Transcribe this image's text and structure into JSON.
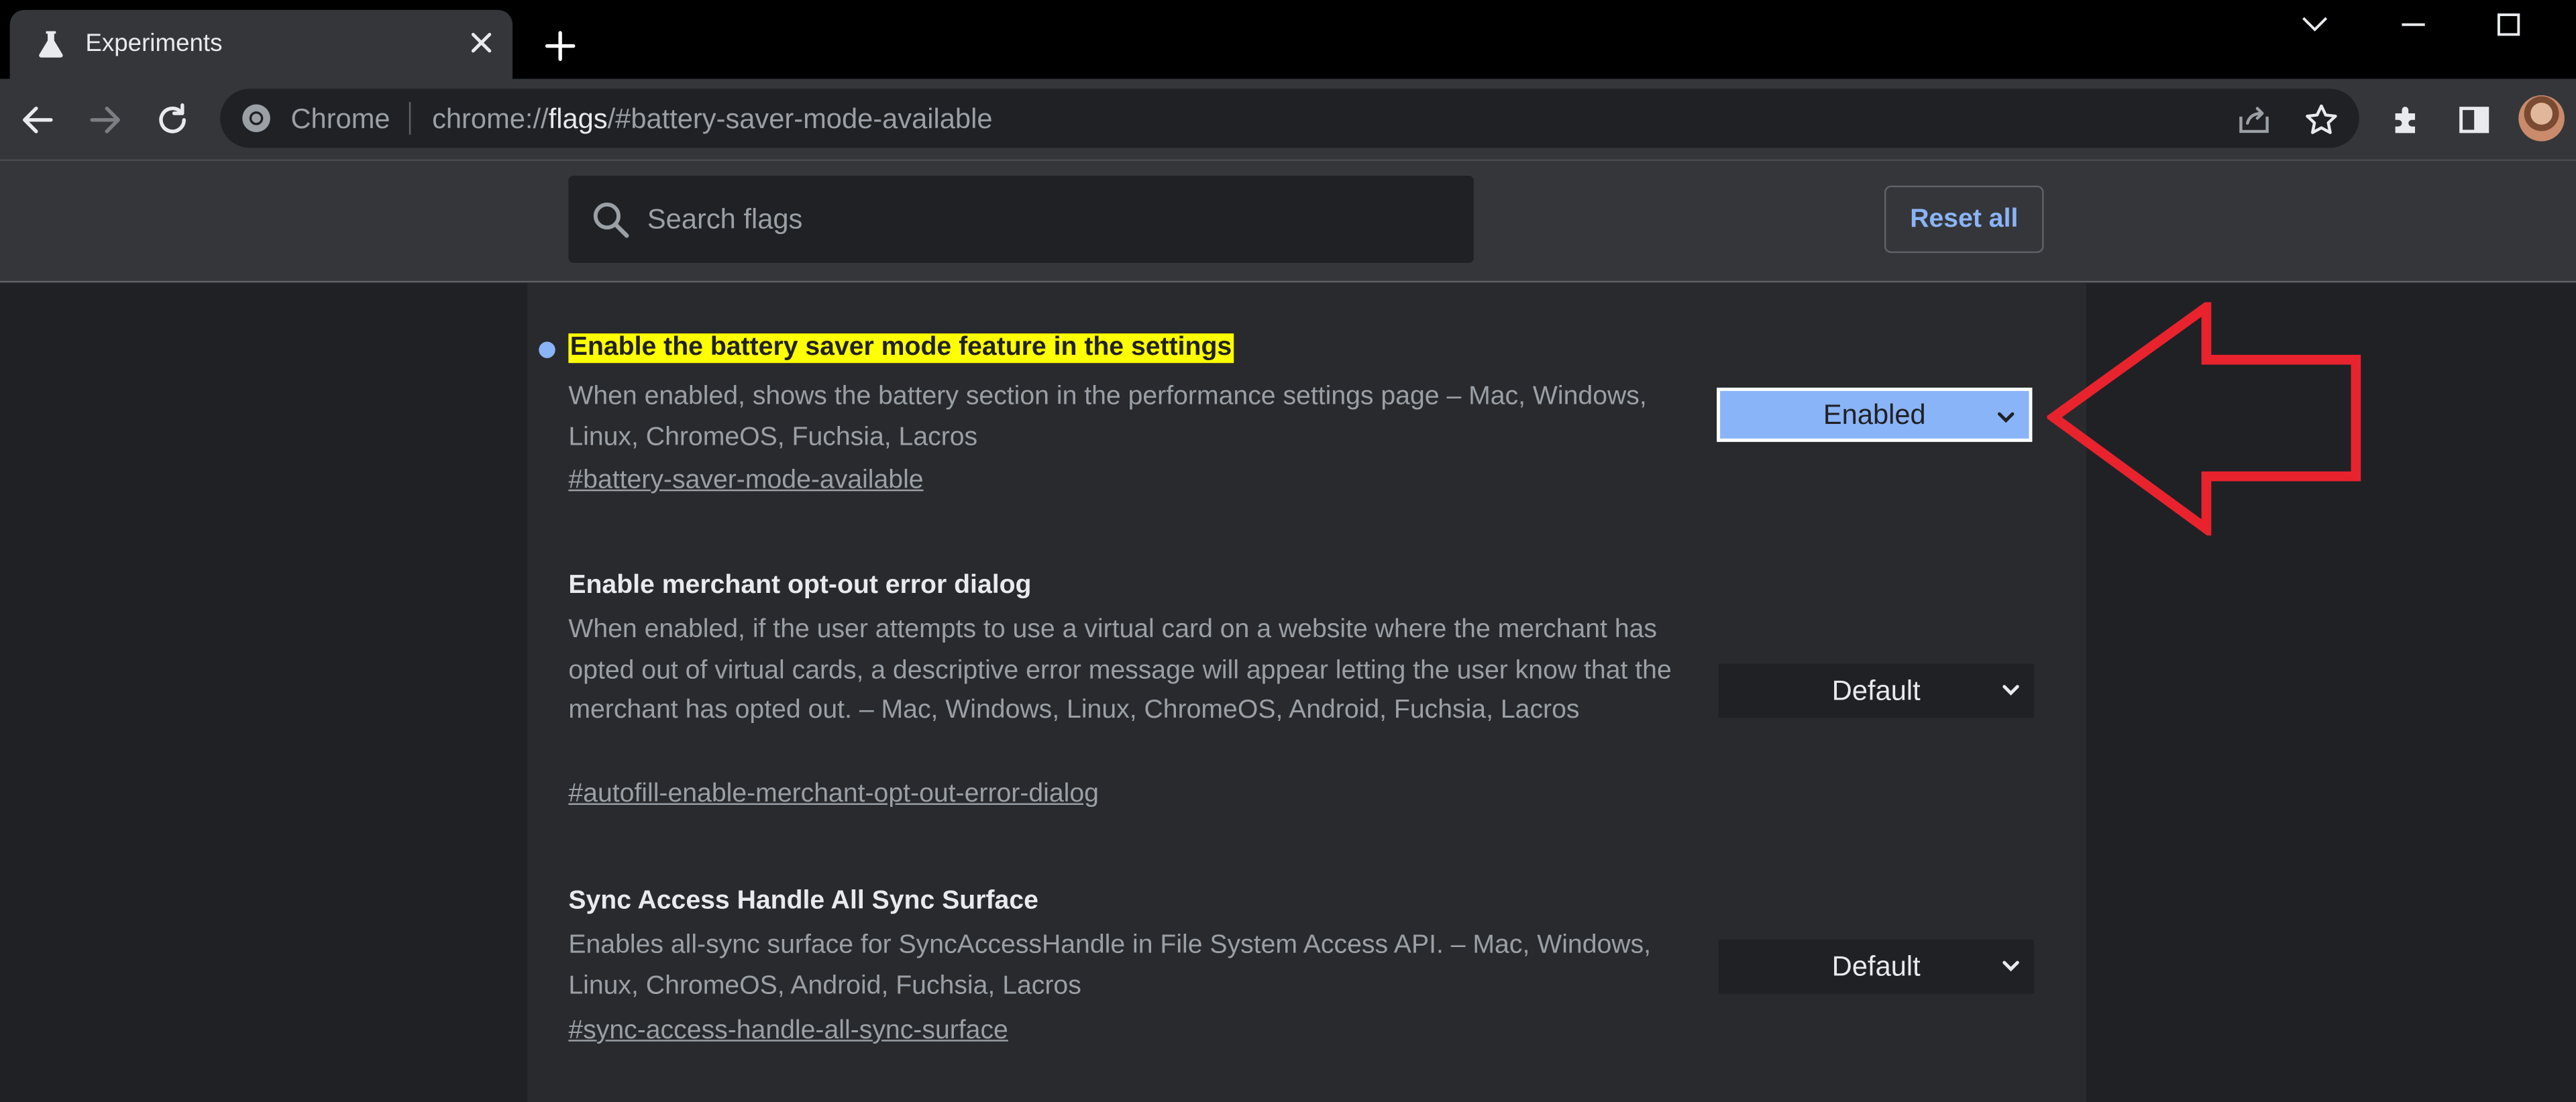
{
  "browser": {
    "tab": {
      "title": "Experiments",
      "favicon": "flask-icon"
    },
    "new_tab_icon": "plus-icon",
    "window_controls": [
      "chevron-down-icon",
      "minimize-icon",
      "maximize-icon"
    ]
  },
  "toolbar": {
    "chip_label": "Chrome",
    "url_scheme": "chrome://",
    "url_host": "flags",
    "url_path": "/#battery-saver-mode-available",
    "icons": [
      "back-icon",
      "forward-icon",
      "reload-icon",
      "share-icon",
      "star-icon",
      "extensions-icon",
      "side-panel-icon",
      "avatar"
    ]
  },
  "header": {
    "search_placeholder": "Search flags",
    "search_value": "",
    "reset_label": "Reset all"
  },
  "flags": [
    {
      "title": "Enable the battery saver mode feature in the settings",
      "description": "When enabled, shows the battery section in the performance settings page – Mac, Windows, Linux, ChromeOS, Fuchsia, Lacros",
      "link": "#battery-saver-mode-available",
      "value": "Enabled",
      "highlighted": true,
      "modified": true
    },
    {
      "title": "Enable merchant opt-out error dialog",
      "description": "When enabled, if the user attempts to use a virtual card on a website where the merchant has opted out of virtual cards, a descriptive error message will appear letting the user know that the merchant has opted out. – Mac, Windows, Linux, ChromeOS, Android, Fuchsia, Lacros",
      "link": "#autofill-enable-merchant-opt-out-error-dialog",
      "value": "Default",
      "highlighted": false,
      "modified": false
    },
    {
      "title": "Sync Access Handle All Sync Surface",
      "description": "Enables all-sync surface for SyncAccessHandle in File System Access API. – Mac, Windows, Linux, ChromeOS, Android, Fuchsia, Lacros",
      "link": "#sync-access-handle-all-sync-surface",
      "value": "Default",
      "highlighted": false,
      "modified": false
    }
  ],
  "colors": {
    "highlight": "#ffff00",
    "accent": "#8ab4f8",
    "annotation_arrow": "#e8232e"
  }
}
